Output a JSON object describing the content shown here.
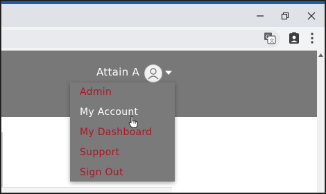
{
  "account_menu": {
    "user_name": "Attain A",
    "items": [
      {
        "label": "Admin"
      },
      {
        "label": "My Account"
      },
      {
        "label": "My Dashboard"
      },
      {
        "label": "Support"
      },
      {
        "label": "Sign Out"
      }
    ]
  },
  "icons": {
    "minimize": "minimize-icon",
    "maximize": "restore-icon",
    "close": "close-icon",
    "translate": "translate-icon",
    "profile": "profile-icon",
    "menu": "more-vert-icon",
    "avatar": "avatar-icon",
    "caret": "caret-down-icon"
  },
  "colors": {
    "header_bg": "#787878",
    "link": "#b01425",
    "hover_text": "#ffffff",
    "titlebar_bg": "#dfe3e8",
    "accent": "#1b5fa8"
  }
}
